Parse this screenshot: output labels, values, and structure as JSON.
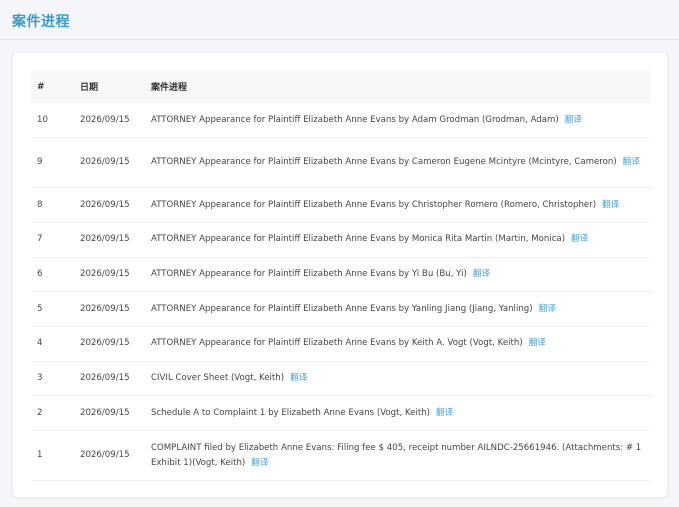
{
  "page": {
    "title": "案件进程"
  },
  "table": {
    "headers": {
      "num": "#",
      "date": "日期",
      "desc": "案件进程"
    },
    "translate_label": "翻译",
    "rows": [
      {
        "num": "10",
        "date": "2026/09/15",
        "desc": "ATTORNEY Appearance for Plaintiff Elizabeth Anne Evans by Adam Grodman (Grodman, Adam)"
      },
      {
        "num": "9",
        "date": "2026/09/15",
        "desc": "ATTORNEY Appearance for Plaintiff Elizabeth Anne Evans by Cameron Eugene Mcintyre (Mcintyre, Cameron)"
      },
      {
        "num": "8",
        "date": "2026/09/15",
        "desc": "ATTORNEY Appearance for Plaintiff Elizabeth Anne Evans by Christopher Romero (Romero, Christopher)"
      },
      {
        "num": "7",
        "date": "2026/09/15",
        "desc": "ATTORNEY Appearance for Plaintiff Elizabeth Anne Evans by Monica Rita Martin (Martin, Monica)"
      },
      {
        "num": "6",
        "date": "2026/09/15",
        "desc": "ATTORNEY Appearance for Plaintiff Elizabeth Anne Evans by Yi Bu (Bu, Yi)"
      },
      {
        "num": "5",
        "date": "2026/09/15",
        "desc": "ATTORNEY Appearance for Plaintiff Elizabeth Anne Evans by Yanling Jiang (Jiang, Yanling)"
      },
      {
        "num": "4",
        "date": "2026/09/15",
        "desc": "ATTORNEY Appearance for Plaintiff Elizabeth Anne Evans by Keith A. Vogt (Vogt, Keith)"
      },
      {
        "num": "3",
        "date": "2026/09/15",
        "desc": "CIVIL Cover Sheet (Vogt, Keith)"
      },
      {
        "num": "2",
        "date": "2026/09/15",
        "desc": "Schedule A to Complaint 1 by Elizabeth Anne Evans (Vogt, Keith)"
      },
      {
        "num": "1",
        "date": "2026/09/15",
        "desc": "COMPLAINT filed by Elizabeth Anne Evans: Filing fee $ 405, receipt number AILNDC-25661946. (Attachments: # 1 Exhibit 1)(Vogt, Keith)"
      }
    ]
  },
  "colors": {
    "accent": "#3a9cc4",
    "link": "#4aa3d8"
  }
}
